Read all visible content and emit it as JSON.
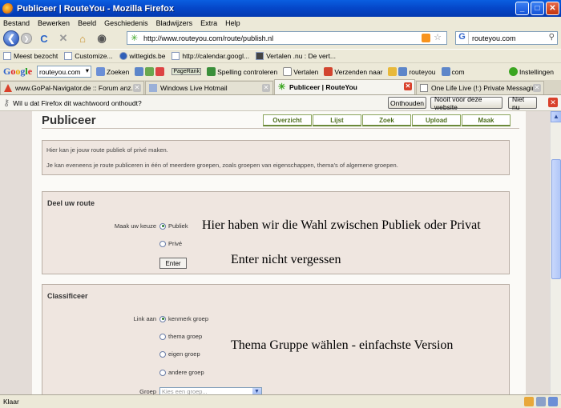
{
  "window": {
    "title": "Publiceer | RouteYou - Mozilla Firefox"
  },
  "menu": [
    "Bestand",
    "Bewerken",
    "Beeld",
    "Geschiedenis",
    "Bladwijzers",
    "Extra",
    "Help"
  ],
  "nav": {
    "url": "http://www.routeyou.com/route/publish.nl",
    "search_value": "routeyou.com"
  },
  "bookmarks": [
    "Meest bezocht",
    "Customize...",
    "wittegids.be",
    "http://calendar.googl...",
    "Vertalen .nu : De vert..."
  ],
  "google_toolbar": {
    "search_value": "routeyou.com",
    "items": [
      "Zoeken",
      "PageRank",
      "Spelling controleren",
      "Vertalen",
      "Verzenden naar",
      "routeyou",
      "com",
      "Instellingen"
    ]
  },
  "tabs": [
    {
      "label": "www.GoPal-Navigator.de :: Forum anz...",
      "active": false
    },
    {
      "label": "Windows Live Hotmail",
      "active": false
    },
    {
      "label": "Publiceer | RouteYou",
      "active": true
    },
    {
      "label": "One Life Live (!:) Private Messaging",
      "active": false
    }
  ],
  "notification": {
    "text": "Wil u dat Firefox dit wachtwoord onthoudt?",
    "buttons": [
      "Onthouden",
      "Nooit voor deze website",
      "Niet nu"
    ]
  },
  "page": {
    "title": "Publiceer",
    "tabs": [
      "Overzicht",
      "Lijst",
      "Zoek",
      "Upload",
      "Maak"
    ],
    "intro": [
      "Hier kan je jouw route publiek of privé maken.",
      "Je kan eveneens je route publiceren in één of meerdere groepen, zoals groepen van eigenschappen, thema's of algemene groepen."
    ],
    "deel": {
      "heading": "Deel uw route",
      "choice_label": "Maak uw keuze",
      "options": [
        "Publiek",
        "Privé"
      ],
      "selected": "Publiek",
      "enter_label": "Enter"
    },
    "classificeer": {
      "heading": "Classificeer",
      "link_label": "Link aan",
      "options": [
        "kenmerk groep",
        "thema groep",
        "eigen groep",
        "andere groep"
      ],
      "selected": "kenmerk groep",
      "group_label": "Groep",
      "group_placeholder": "Kies een groep..."
    }
  },
  "annotations": {
    "wahl": "Hier haben wir die Wahl zwischen  Publiek oder Privat",
    "enter": "Enter nicht vergessen",
    "thema": "Thema Gruppe wählen  - einfachste Version"
  },
  "status": "Klaar"
}
